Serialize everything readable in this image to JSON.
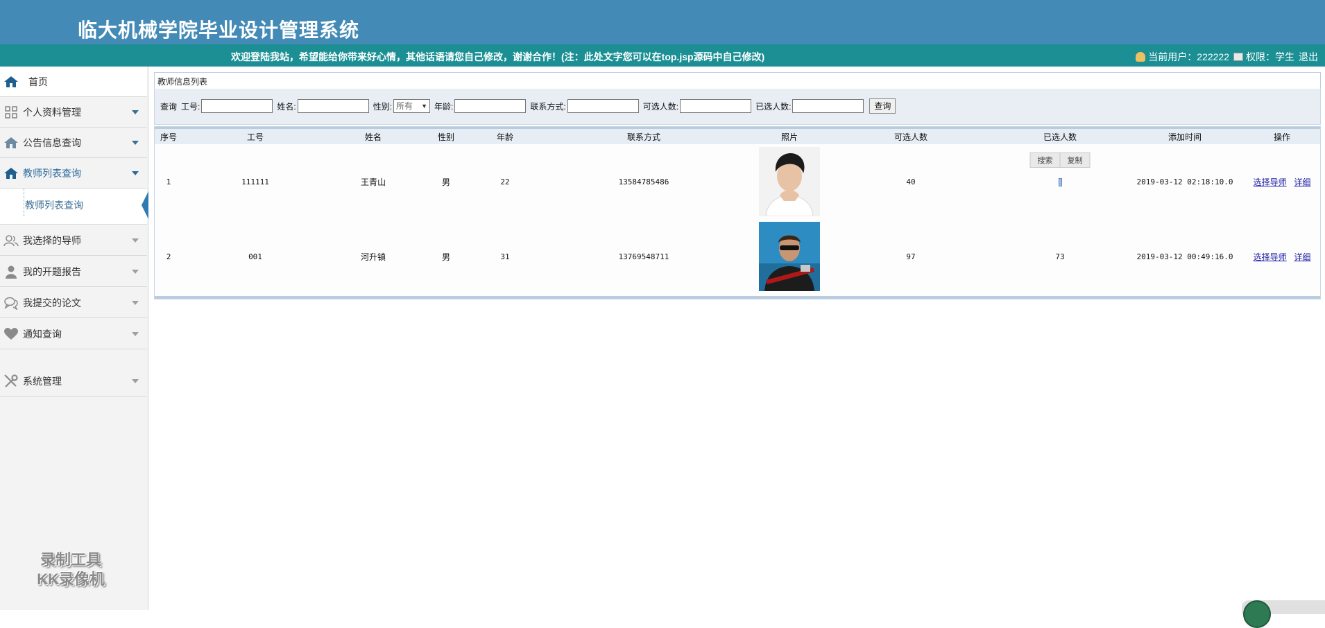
{
  "header": {
    "title": "临大机械学院毕业设计管理系统",
    "welcome": "欢迎登陆我站，希望能给你带来好心情，其他话语请您自己修改，谢谢合作！(注：此处文字您可以在top.jsp源码中自己修改)",
    "current_user_label": "当前用户：222222",
    "role_label": "权限：学生",
    "logout": "退出"
  },
  "sidebar": {
    "items": [
      {
        "label": "首页",
        "icon": "home-icon"
      },
      {
        "label": "个人资料管理",
        "icon": "grid-icon"
      },
      {
        "label": "公告信息查询",
        "icon": "home-icon"
      },
      {
        "label": "教师列表查询",
        "icon": "home-icon"
      },
      {
        "label": "我选择的导师",
        "icon": "users-icon"
      },
      {
        "label": "我的开题报告",
        "icon": "user-icon"
      },
      {
        "label": "我提交的论文",
        "icon": "chat-icon"
      },
      {
        "label": "通知查询",
        "icon": "heart-icon"
      },
      {
        "label": "系统管理",
        "icon": "tools-icon"
      }
    ],
    "submenu": {
      "label": "教师列表查询"
    }
  },
  "watermark": {
    "line1": "录制工具",
    "line2": "KK录像机"
  },
  "panel": {
    "title": "教师信息列表"
  },
  "search": {
    "query_label": "查询",
    "id_label": "工号:",
    "name_label": "姓名:",
    "gender_label": "性别:",
    "gender_value": "所有",
    "age_label": "年龄:",
    "contact_label": "联系方式:",
    "available_label": "可选人数:",
    "selected_label": "已选人数:",
    "button": "查询"
  },
  "table": {
    "headers": [
      "序号",
      "工号",
      "姓名",
      "性别",
      "年龄",
      "联系方式",
      "照片",
      "可选人数",
      "已选人数",
      "添加时间",
      "操作"
    ],
    "rows": [
      {
        "no": "1",
        "id": "111111",
        "name": "王青山",
        "gender": "男",
        "age": "22",
        "contact": "13584785486",
        "available": "40",
        "selected": "",
        "time": "2019-03-12 02:18:10.0",
        "op1": "选择导师",
        "op2": "详细"
      },
      {
        "no": "2",
        "id": "001",
        "name": "河升镇",
        "gender": "男",
        "age": "31",
        "contact": "13769548711",
        "available": "97",
        "selected": "73",
        "time": "2019-03-12 00:49:16.0",
        "op1": "选择导师",
        "op2": "详细"
      }
    ],
    "popup": {
      "search": "搜索",
      "copy": "复制"
    }
  }
}
